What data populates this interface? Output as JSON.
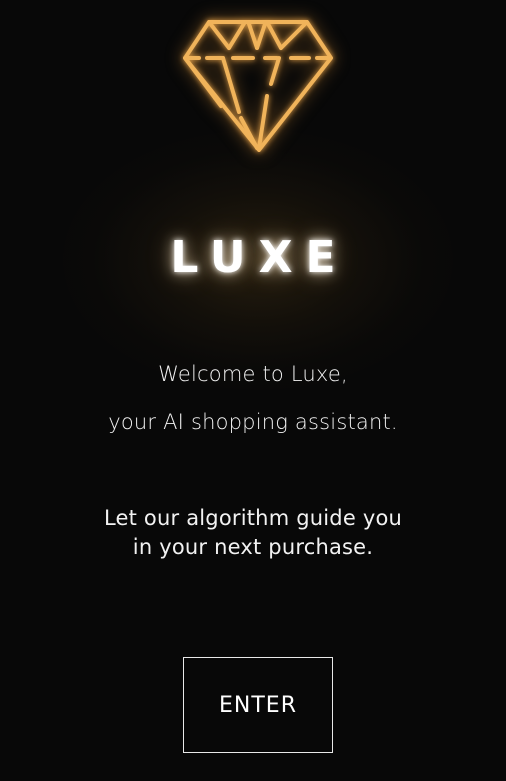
{
  "brand": {
    "name": "LUXE",
    "logo_icon": "diamond-icon",
    "accent_color": "#F0B35A"
  },
  "welcome": {
    "line1": "Welcome to Luxe,",
    "line2": "your AI shopping assistant."
  },
  "tagline": {
    "line1": "Let our algorithm guide you",
    "line2": "in your next purchase."
  },
  "actions": {
    "enter_label": "ENTER"
  },
  "theme": {
    "background": "#080808",
    "text": "#FFFFFF"
  }
}
